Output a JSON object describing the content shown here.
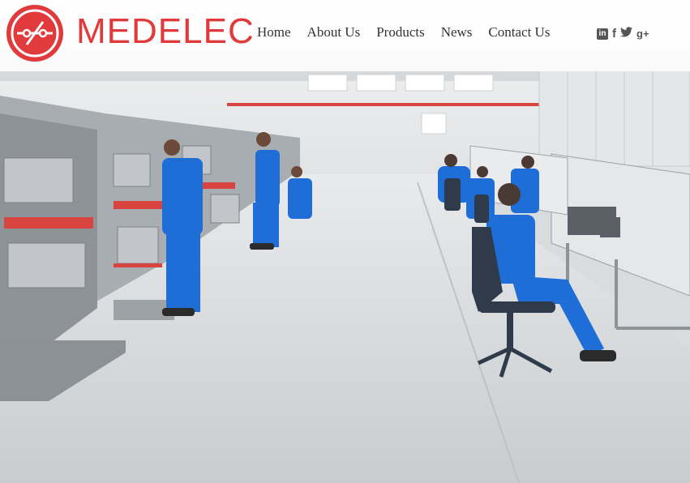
{
  "brand": {
    "name": "MEDELEC",
    "logo_icon": "medelec-logo-icon",
    "color": "#e03a3c"
  },
  "nav": {
    "items": [
      "Home",
      "About Us",
      "Products",
      "News",
      "Contact Us"
    ]
  },
  "social": {
    "icons": [
      "linkedin-icon",
      "facebook-icon",
      "twitter-icon",
      "google-plus-icon"
    ]
  },
  "hero": {
    "image": "factory-assembly-floor-photo",
    "accent_color": "#1f6ed8"
  }
}
